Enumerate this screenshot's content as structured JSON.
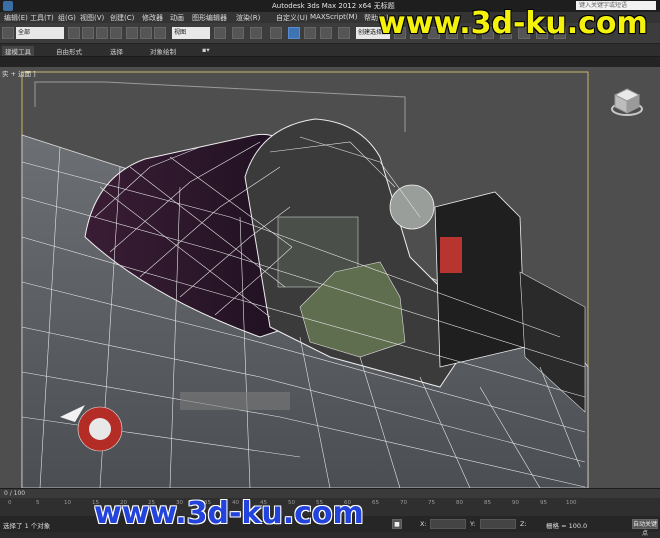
{
  "window": {
    "title": "Autodesk 3ds Max  2012 x64      无标题",
    "search_placeholder": "键入关键字或短语"
  },
  "menu": [
    "编辑(E)",
    "工具(T)",
    "组(G)",
    "视图(V)",
    "创建(C)",
    "修改器",
    "动画",
    "图形编辑器",
    "渲染(R)",
    "自定义(U)",
    "MAXScript(M)",
    "帮助(H)"
  ],
  "toolbar": {
    "selection_filter": "全部",
    "reference_coord": "视图",
    "named_selection": "创建选择集"
  },
  "ribbon": {
    "tabs": [
      "建模工具",
      "自由形式",
      "选择",
      "对象绘制"
    ],
    "active_tab": "建模工具"
  },
  "viewport": {
    "label": "[+] [透视] [真实 + 边面]",
    "label_visible": "实 + 边面 ]",
    "background": "#4e4e4e"
  },
  "trackbar": {
    "ticks": [
      "0",
      "5",
      "10",
      "15",
      "20",
      "25",
      "30",
      "35",
      "40",
      "45",
      "50",
      "55",
      "60",
      "65",
      "70",
      "75",
      "80",
      "85",
      "90",
      "95",
      "100"
    ],
    "frame_display": "0 / 100"
  },
  "status": {
    "selection_text": "选择了 1 个对象",
    "x_label": "X:",
    "y_label": "Y:",
    "z_label": "Z:",
    "grid_text": "栅格 = 100.0",
    "auto_key": "自动关键点"
  },
  "watermarks": {
    "top": "www.3d-ku.com",
    "bottom": "www.3d-ku.com"
  },
  "colors": {
    "accent": "#3d74b3",
    "watermark_top": "#f4f10a",
    "watermark_bottom": "#2244dd"
  }
}
